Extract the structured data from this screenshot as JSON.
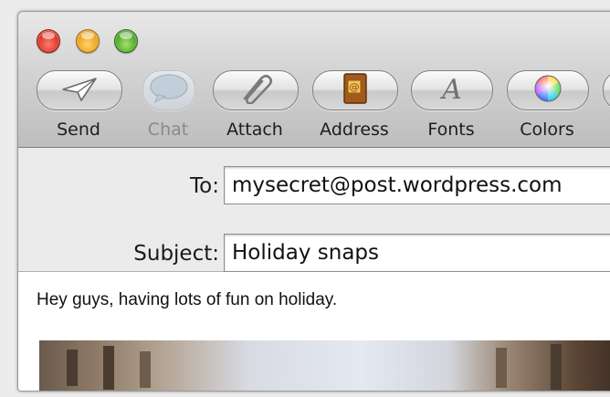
{
  "toolbar": {
    "buttons": [
      {
        "label": "Send",
        "icon": "paper-plane-icon",
        "enabled": true
      },
      {
        "label": "Chat",
        "icon": "speech-bubble-icon",
        "enabled": false
      },
      {
        "label": "Attach",
        "icon": "paperclip-icon",
        "enabled": true
      },
      {
        "label": "Address",
        "icon": "address-book-icon",
        "enabled": true
      },
      {
        "label": "Fonts",
        "icon": "font-a-icon",
        "enabled": true
      },
      {
        "label": "Colors",
        "icon": "color-wheel-icon",
        "enabled": true
      }
    ]
  },
  "headers": {
    "to_label": "To:",
    "to_value": "mysecret@post.wordpress.com",
    "subject_label": "Subject:",
    "subject_value": "Holiday snaps"
  },
  "message": {
    "body_text": "Hey guys, having lots of fun on holiday."
  },
  "colors": {
    "close": "#d3281b",
    "minimize": "#e59a12",
    "maximize": "#3f9b1f"
  }
}
